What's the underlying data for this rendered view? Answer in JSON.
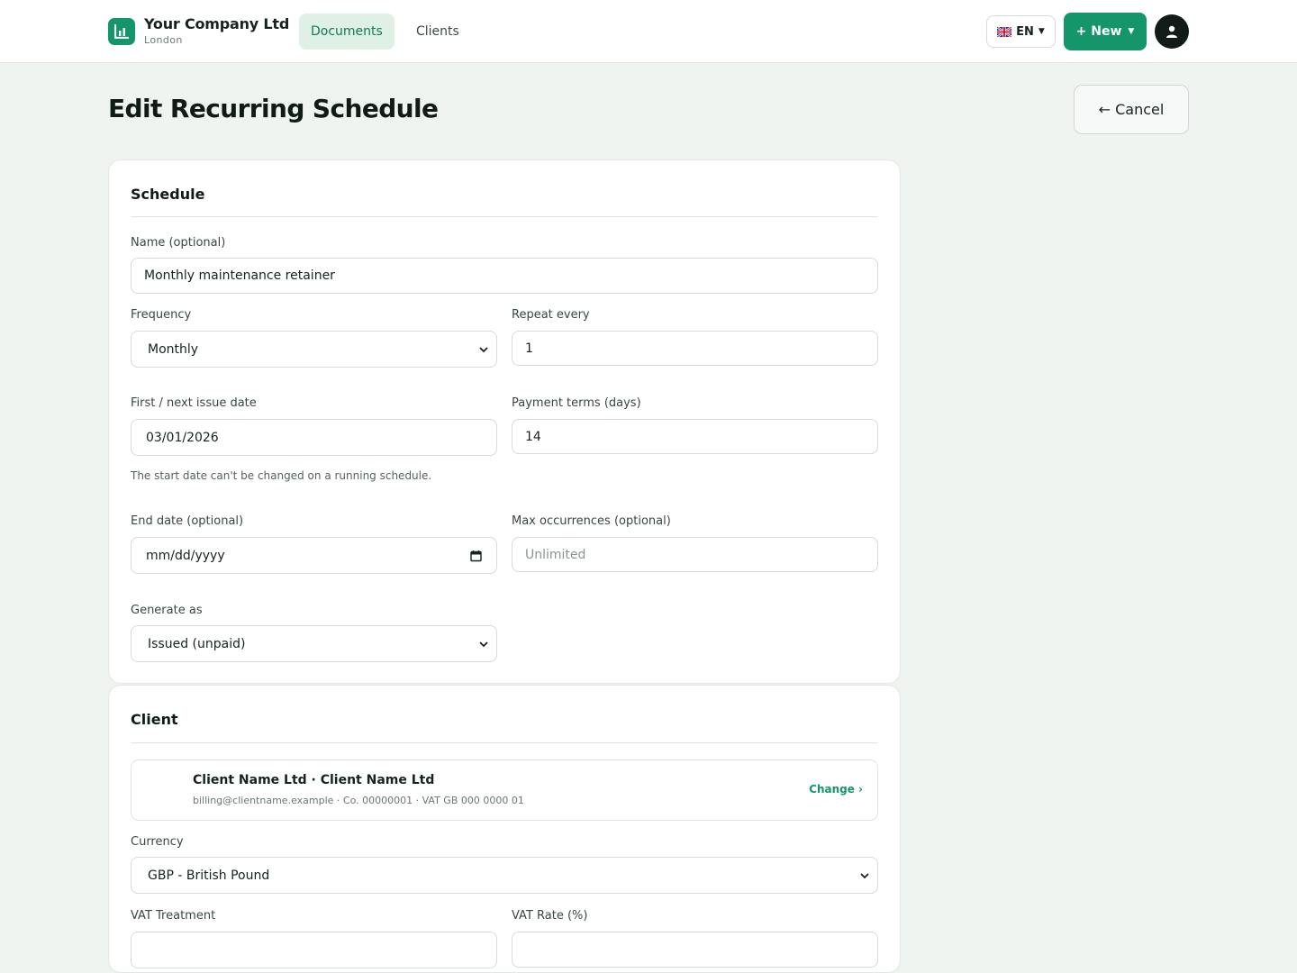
{
  "header": {
    "company_name": "Your Company Ltd",
    "company_city": "London",
    "nav": [
      "Documents",
      "Clients"
    ],
    "lang": "EN",
    "new_label": "+ New"
  },
  "page": {
    "title": "Edit Recurring Schedule",
    "cancel_label": "← Cancel"
  },
  "schedule": {
    "heading": "Schedule",
    "name_label": "Name (optional)",
    "name_value": "Monthly maintenance retainer",
    "frequency_label": "Frequency",
    "frequency_value": "Monthly",
    "repeat_label": "Repeat every",
    "repeat_value": "1",
    "first_date_label": "First / next issue date",
    "first_date_value": "03/01/2026",
    "first_date_hint": "The start date can't be changed on a running schedule.",
    "terms_label": "Payment terms (days)",
    "terms_value": "14",
    "end_date_label": "End date (optional)",
    "end_date_placeholder": "mm/dd/yyyy",
    "max_label": "Max occurrences (optional)",
    "max_placeholder": "Unlimited",
    "generate_label": "Generate as",
    "generate_value": "Issued (unpaid)"
  },
  "client": {
    "heading": "Client",
    "name": "Client Name Ltd · Client Name Ltd",
    "meta": "billing@clientname.example · Co. 00000001 · VAT GB 000 0000 01",
    "change_label": "Change ›",
    "currency_label": "Currency",
    "currency_value": "GBP - British Pound",
    "vat_treatment_label": "VAT Treatment",
    "vat_rate_label": "VAT Rate (%)"
  },
  "colors": {
    "accent": "#14966a",
    "background": "#eff4f1",
    "dark": "#111b17"
  },
  "icons": [
    "chart-logo-icon",
    "uk-flag-icon",
    "caret-down-icon",
    "user-icon",
    "chevron-down-icon",
    "calendar-icon"
  ]
}
